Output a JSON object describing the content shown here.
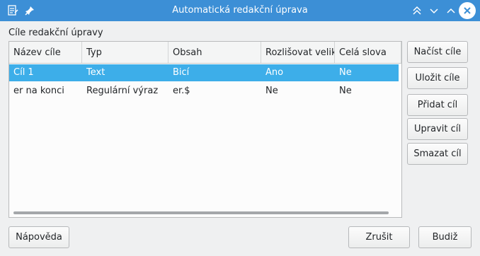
{
  "window": {
    "title": "Automatická redakční úprava"
  },
  "group": {
    "label": "Cíle redakční úpravy"
  },
  "table": {
    "columns": [
      "Název cíle",
      "Typ",
      "Obsah",
      "Rozlišovat velikost",
      "Celá slova"
    ],
    "rows": [
      {
        "name": "Cíl 1",
        "type": "Text",
        "content": "Bicí",
        "match_case": "Ano",
        "whole_words": "Ne"
      },
      {
        "name": "er na konci",
        "type": "Regulární výraz",
        "content": "er.$",
        "match_case": "Ne",
        "whole_words": "Ne"
      }
    ]
  },
  "side_buttons": {
    "load": "Načíst cíle",
    "save": "Uložit cíle",
    "add": "Přidat cíl",
    "edit": "Upravit cíl",
    "delete": "Smazat cíl"
  },
  "footer": {
    "help": "Nápověda",
    "cancel": "Zrušit",
    "ok": "Budiž"
  },
  "icons": {
    "app": "document-edit-icon",
    "pin": "pin-icon",
    "keep_above": "double-chevron-up-icon",
    "minimize": "chevron-down-icon",
    "maximize": "chevron-up-icon",
    "close": "close-icon"
  },
  "colors": {
    "titlebar": "#3c8fd6",
    "selection": "#3daee9",
    "window": "#eff0f1"
  }
}
